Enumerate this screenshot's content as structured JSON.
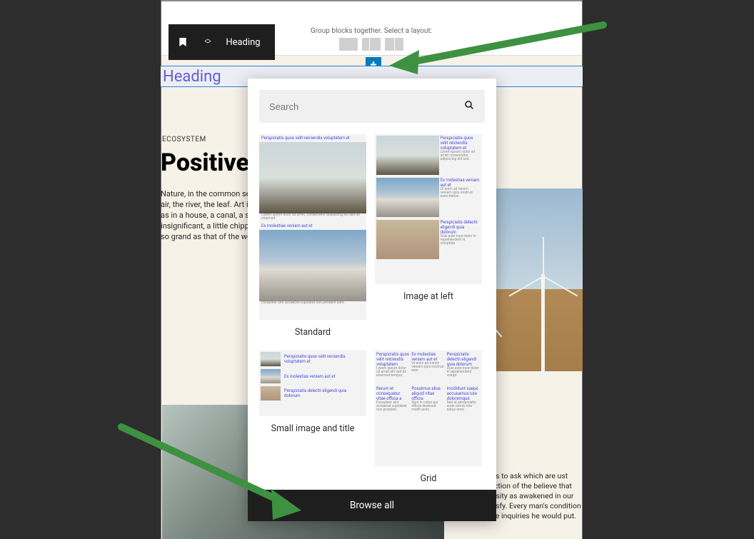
{
  "toolbar": {
    "block_type": "Heading"
  },
  "group_prompt": "Group blocks together. Select a layout:",
  "heading_placeholder": "Heading",
  "eyebrow": "ECOSYSTEM",
  "big_title": "Positive",
  "body_text": "Nature, in the common sense, refers to essences unchanged by man; space, the air, the river, the leaf. Art is applied to the mixture of his will with the same things, as in a house, a canal, a statue, a picture. But his operations taken together are so insignificant, a little chipping, baking, patching, and washing, that in an impression so grand as that of the world on the human mind, they do not vary the result.",
  "lower_text": "ve no questions to ask which are ust trust the perfection of the believe that whatever curiosity as awakened in our minds, the satisfy. Every man's condition is a hic to those inquiries he would put.",
  "popover": {
    "search_placeholder": "Search",
    "mini_title_1": "Perspiciatis quos velit reiciendis voluptatem et",
    "mini_title_2": "Ex molestias veniam aut et",
    "mini_title_3": "Perspiciatis delectii eligendi quia dolorum",
    "mini_title_4": "Perspiciatis quos velit reiciendis voluptatem et",
    "mini_title_g1": "Perspiciatis quos velit reiciendis voluptatem",
    "mini_title_g2": "Ex molestias veniam aut et",
    "mini_title_g3": "Perspiciatis delectii eligendi quia dolorum",
    "mini_title_g4": "Rerum et consequatur vitae officia a",
    "mini_title_g5": "Possimus alius aliquid vitae officia",
    "mini_title_g6": "Incididunt saepe accusamus iure doloremque",
    "patterns": [
      {
        "label": "Standard"
      },
      {
        "label": "Image at left"
      },
      {
        "label": "Small image and title"
      },
      {
        "label": "Grid"
      }
    ],
    "browse_all": "Browse all"
  },
  "annotations": {
    "arrow_top_target": "add-block-button",
    "arrow_bottom_target": "browse-all-button"
  }
}
